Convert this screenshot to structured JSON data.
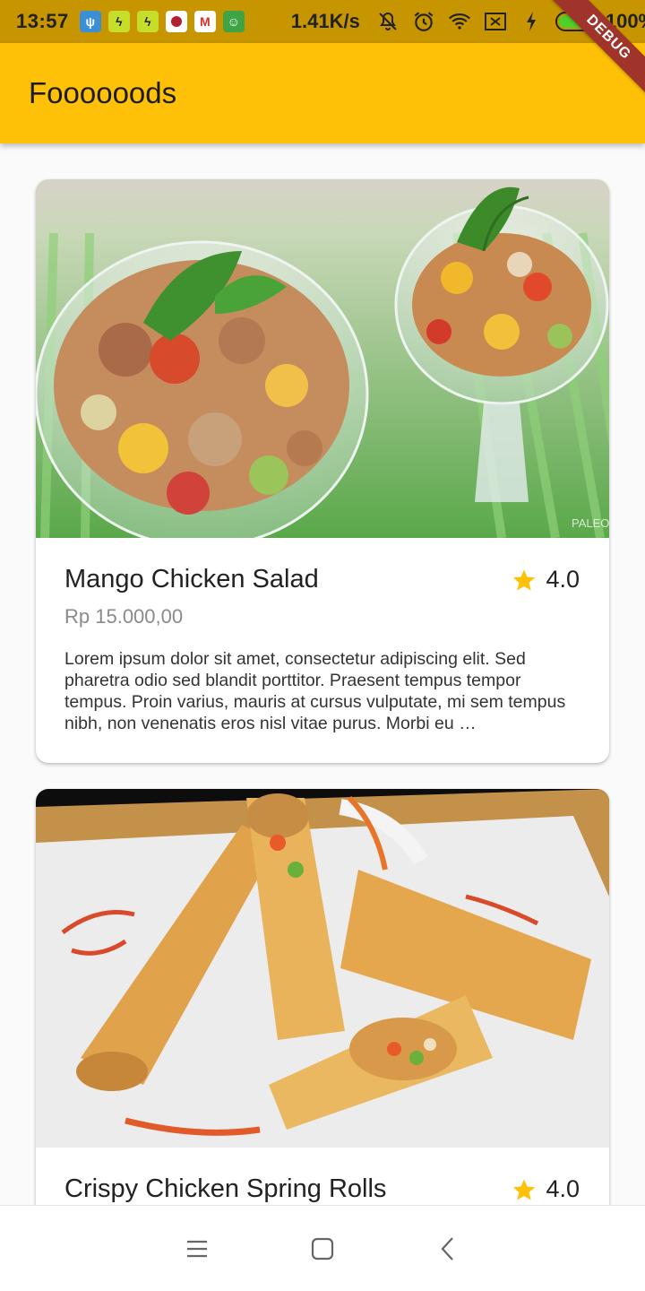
{
  "status_bar": {
    "time": "13:57",
    "speed": "1.41K/s",
    "battery_percent": "100%",
    "battery_level": 1.0,
    "notification_icons": [
      "usb-icon",
      "charge-icon",
      "charge-icon",
      "app-icon",
      "gmail-icon",
      "frog-icon"
    ],
    "status_icons": [
      "mute-icon",
      "alarm-icon",
      "wifi-icon",
      "no-sim-icon",
      "charging-icon"
    ]
  },
  "debug_banner": "DEBUG",
  "app_bar": {
    "title": "Foooooods"
  },
  "foods": [
    {
      "name": "Mango Chicken Salad",
      "rating": "4.0",
      "price": "Rp 15.000,00",
      "description": "Lorem ipsum dolor sit amet, consectetur adipiscing elit. Sed pharetra odio sed blandit porttitor. Praesent tempus tempor tempus. Proin varius, mauris at cursus vulputate, mi sem tempus nibh, non venenatis eros nisl vitae purus. Morbi eu …",
      "image": "mango-chicken-salad-photo"
    },
    {
      "name": "Crispy Chicken Spring Rolls",
      "rating": "4.0",
      "image": "spring-rolls-photo"
    }
  ],
  "colors": {
    "app_bar": "#ffc107",
    "status_bar": "#c79500",
    "star": "#ffc107",
    "debug_ribbon": "#a0342b"
  },
  "nav_bar": {
    "buttons": [
      "menu-icon",
      "home-icon",
      "back-icon"
    ]
  }
}
